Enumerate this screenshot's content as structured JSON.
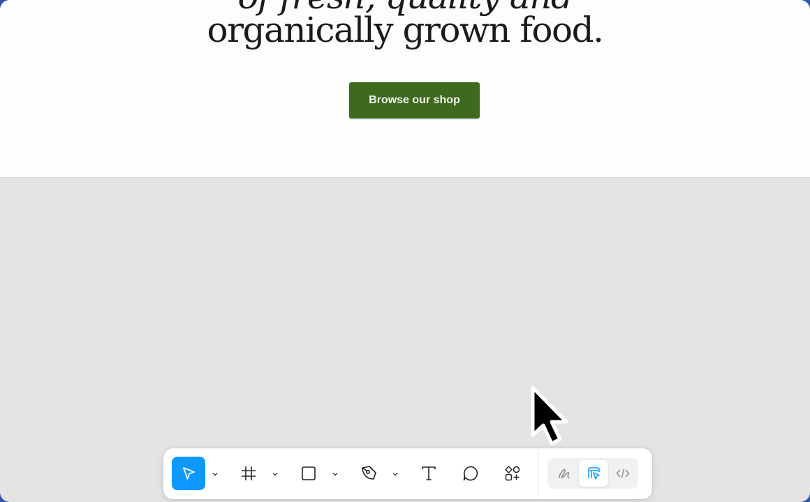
{
  "canvas": {
    "headline_line1": "of fresh, quality and",
    "headline_line2": "organically grown food.",
    "cta_label": "Browse our shop",
    "cta_color": "#3d6a1d",
    "background": "#e4e4e4"
  },
  "toolbar": {
    "accent": "#0d99ff",
    "tools": [
      {
        "name": "move",
        "icon": "pointer-icon",
        "active": true,
        "has_menu": true
      },
      {
        "name": "frame",
        "icon": "frame-icon",
        "active": false,
        "has_menu": true
      },
      {
        "name": "shape",
        "icon": "rectangle-icon",
        "active": false,
        "has_menu": true
      },
      {
        "name": "pen",
        "icon": "pen-icon",
        "active": false,
        "has_menu": true
      },
      {
        "name": "text",
        "icon": "text-icon",
        "active": false,
        "has_menu": false
      },
      {
        "name": "comment",
        "icon": "comment-icon",
        "active": false,
        "has_menu": false
      },
      {
        "name": "actions",
        "icon": "components-icon",
        "active": false,
        "has_menu": false
      }
    ],
    "modes": [
      {
        "name": "draw",
        "icon": "draw-icon",
        "active": false
      },
      {
        "name": "design",
        "icon": "design-icon",
        "active": true
      },
      {
        "name": "dev",
        "icon": "code-icon",
        "active": false
      }
    ]
  }
}
